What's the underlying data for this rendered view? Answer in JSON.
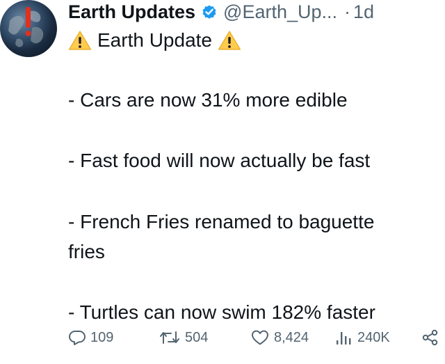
{
  "author": {
    "name": "Earth Updates",
    "handle": "@Earth_Up...",
    "separator": "·",
    "time": "1d"
  },
  "icons": {
    "avatar": "earth-avatar",
    "verified": "verified-badge-icon",
    "warning": "warning-icon",
    "reply": "reply-icon",
    "retweet": "retweet-icon",
    "like": "heart-icon",
    "views": "views-icon",
    "share": "share-icon"
  },
  "colors": {
    "verified": "#1d9bf0",
    "warning": "#ffcc4d",
    "text": "#0f1419",
    "muted": "#536471"
  },
  "tweet": {
    "title": "Earth Update",
    "lines": [
      "- Cars are now 31% more edible",
      "- Fast food will now actually be fast",
      "- French Fries renamed to baguette",
      "fries",
      "- Turtles can now swim 182% faster"
    ]
  },
  "stats": {
    "replies": "109",
    "retweets": "504",
    "likes": "8,424",
    "views": "240K"
  }
}
